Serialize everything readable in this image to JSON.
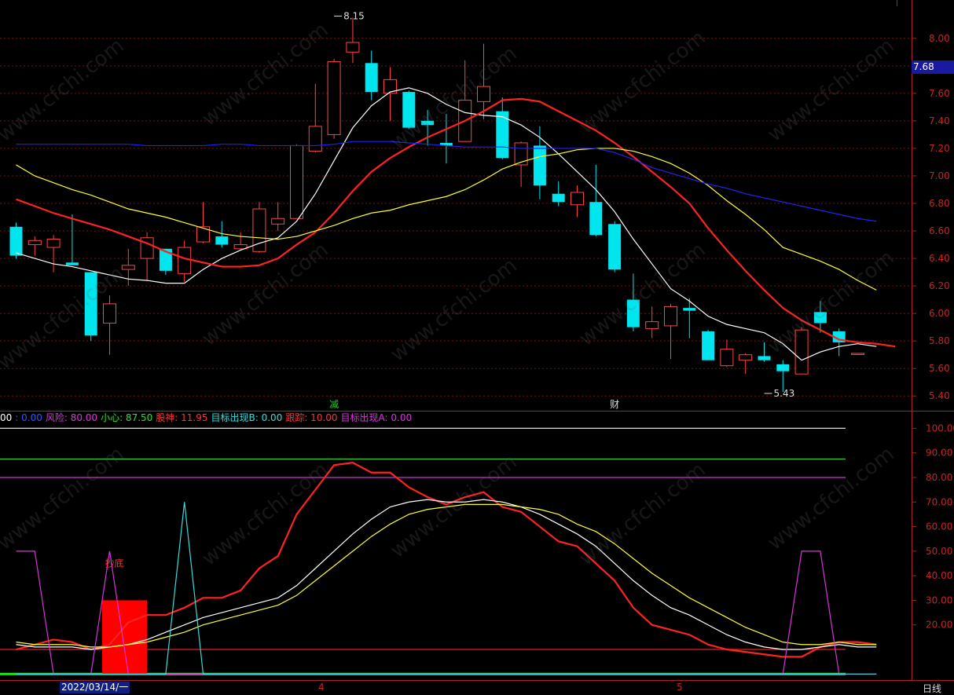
{
  "price_tag": "7.68",
  "date_label": "2022/03/14/一",
  "period_label": "日线",
  "x_labels": [
    "4",
    "5"
  ],
  "watermark": "www.cfchi.com",
  "legend": [
    {
      "text": "00",
      "color": "#ffffff"
    },
    {
      "text": ": 0.00",
      "color": "#3355ff"
    },
    {
      "text": "风险: 80.00",
      "color": "#dd33dd"
    },
    {
      "text": "小心: 87.50",
      "color": "#33dd33"
    },
    {
      "text": "股神: 11.95",
      "color": "#ff3333"
    },
    {
      "text": "目标出现B: 0.00",
      "color": "#33dddd"
    },
    {
      "text": "跟踪: 10.00",
      "color": "#ff3333"
    },
    {
      "text": "目标出现A: 0.00",
      "color": "#dd33dd"
    }
  ],
  "chart_data": [
    {
      "type": "candlestick",
      "y_ticks": [
        5.4,
        5.6,
        5.8,
        6.0,
        6.2,
        6.4,
        6.6,
        6.8,
        7.0,
        7.2,
        7.4,
        7.6,
        7.8,
        8.0
      ],
      "ylim": [
        5.31,
        8.25
      ],
      "annotations": [
        {
          "text": "8.15",
          "value": 8.15,
          "index": 17
        },
        {
          "text": "5.43",
          "value": 5.43,
          "index": 40
        }
      ],
      "event_markers": [
        {
          "text": "减",
          "index": 17,
          "color": "#22cc22"
        },
        {
          "text": "财",
          "index": 32,
          "color": "#dddddd"
        }
      ],
      "candles": [
        {
          "o": 6.63,
          "h": 6.66,
          "l": 6.4,
          "c": 6.42
        },
        {
          "o": 6.5,
          "h": 6.56,
          "l": 6.42,
          "c": 6.53
        },
        {
          "o": 6.48,
          "h": 6.57,
          "l": 6.3,
          "c": 6.54
        },
        {
          "o": 6.37,
          "h": 6.72,
          "l": 6.35,
          "c": 6.35
        },
        {
          "o": 6.3,
          "h": 6.3,
          "l": 5.8,
          "c": 5.84
        },
        {
          "o": 5.93,
          "h": 6.13,
          "l": 5.7,
          "c": 6.07
        },
        {
          "o": 6.32,
          "h": 6.47,
          "l": 6.2,
          "c": 6.35
        },
        {
          "o": 6.4,
          "h": 6.59,
          "l": 6.24,
          "c": 6.55
        },
        {
          "o": 6.47,
          "h": 6.47,
          "l": 6.28,
          "c": 6.31
        },
        {
          "o": 6.29,
          "h": 6.53,
          "l": 6.23,
          "c": 6.48
        },
        {
          "o": 6.52,
          "h": 6.81,
          "l": 6.51,
          "c": 6.63
        },
        {
          "o": 6.56,
          "h": 6.67,
          "l": 6.48,
          "c": 6.5
        },
        {
          "o": 6.47,
          "h": 6.59,
          "l": 6.46,
          "c": 6.5
        },
        {
          "o": 6.45,
          "h": 6.81,
          "l": 6.44,
          "c": 6.76
        },
        {
          "o": 6.65,
          "h": 6.81,
          "l": 6.6,
          "c": 6.69
        },
        {
          "o": 6.69,
          "h": 7.23,
          "l": 6.69,
          "c": 7.22
        },
        {
          "o": 7.18,
          "h": 7.67,
          "l": 7.17,
          "c": 7.36
        },
        {
          "o": 7.3,
          "h": 7.85,
          "l": 7.27,
          "c": 7.83
        },
        {
          "o": 7.9,
          "h": 8.15,
          "l": 7.82,
          "c": 7.97
        },
        {
          "o": 7.82,
          "h": 7.91,
          "l": 7.55,
          "c": 7.61
        },
        {
          "o": 7.6,
          "h": 7.79,
          "l": 7.4,
          "c": 7.7
        },
        {
          "o": 7.61,
          "h": 7.62,
          "l": 7.34,
          "c": 7.35
        },
        {
          "o": 7.4,
          "h": 7.48,
          "l": 7.22,
          "c": 7.37
        },
        {
          "o": 7.24,
          "h": 7.45,
          "l": 7.09,
          "c": 7.22
        },
        {
          "o": 7.25,
          "h": 7.84,
          "l": 7.25,
          "c": 7.55
        },
        {
          "o": 7.54,
          "h": 7.96,
          "l": 7.41,
          "c": 7.65
        },
        {
          "o": 7.47,
          "h": 7.57,
          "l": 7.12,
          "c": 7.13
        },
        {
          "o": 7.08,
          "h": 7.25,
          "l": 6.92,
          "c": 7.24
        },
        {
          "o": 7.22,
          "h": 7.36,
          "l": 6.83,
          "c": 6.93
        },
        {
          "o": 6.87,
          "h": 6.96,
          "l": 6.78,
          "c": 6.81
        },
        {
          "o": 6.79,
          "h": 6.93,
          "l": 6.7,
          "c": 6.88
        },
        {
          "o": 6.81,
          "h": 7.08,
          "l": 6.56,
          "c": 6.57
        },
        {
          "o": 6.65,
          "h": 6.67,
          "l": 6.3,
          "c": 6.32
        },
        {
          "o": 6.1,
          "h": 6.29,
          "l": 5.87,
          "c": 5.9
        },
        {
          "o": 5.89,
          "h": 6.05,
          "l": 5.82,
          "c": 5.94
        },
        {
          "o": 5.91,
          "h": 6.07,
          "l": 5.67,
          "c": 6.05
        },
        {
          "o": 6.04,
          "h": 6.11,
          "l": 5.82,
          "c": 6.02
        },
        {
          "o": 5.87,
          "h": 5.88,
          "l": 5.66,
          "c": 5.66
        },
        {
          "o": 5.62,
          "h": 5.81,
          "l": 5.61,
          "c": 5.74
        },
        {
          "o": 5.66,
          "h": 5.71,
          "l": 5.56,
          "c": 5.7
        },
        {
          "o": 5.69,
          "h": 5.79,
          "l": 5.65,
          "c": 5.66
        },
        {
          "o": 5.63,
          "h": 5.66,
          "l": 5.43,
          "c": 5.58
        },
        {
          "o": 5.56,
          "h": 5.9,
          "l": 5.56,
          "c": 5.88
        },
        {
          "o": 6.01,
          "h": 6.09,
          "l": 5.86,
          "c": 5.93
        },
        {
          "o": 5.87,
          "h": 5.89,
          "l": 5.69,
          "c": 5.79
        },
        {
          "o": 5.71,
          "h": 5.71,
          "l": 5.71,
          "c": 5.71
        }
      ],
      "ma_lines": [
        {
          "color": "#ffffff",
          "values": [
            6.44,
            6.4,
            6.36,
            6.34,
            6.31,
            6.28,
            6.25,
            6.24,
            6.22,
            6.22,
            6.32,
            6.4,
            6.46,
            6.51,
            6.55,
            6.67,
            6.87,
            7.11,
            7.35,
            7.51,
            7.61,
            7.64,
            7.6,
            7.52,
            7.46,
            7.44,
            7.43,
            7.37,
            7.28,
            7.16,
            7.03,
            6.9,
            6.74,
            6.54,
            6.36,
            6.18,
            6.09,
            5.98,
            5.92,
            5.89,
            5.86,
            5.78,
            5.66,
            5.72,
            5.76,
            5.78,
            5.76
          ]
        },
        {
          "color": "#ff2222",
          "values": [
            6.83,
            6.78,
            6.73,
            6.69,
            6.65,
            6.61,
            6.56,
            6.51,
            6.45,
            6.4,
            6.37,
            6.34,
            6.34,
            6.35,
            6.4,
            6.5,
            6.59,
            6.73,
            6.89,
            7.03,
            7.13,
            7.21,
            7.28,
            7.34,
            7.4,
            7.47,
            7.55,
            7.56,
            7.54,
            7.47,
            7.4,
            7.33,
            7.24,
            7.14,
            7.03,
            6.92,
            6.8,
            6.62,
            6.46,
            6.31,
            6.17,
            6.04,
            5.95,
            5.88,
            5.81,
            5.79,
            5.78,
            5.76
          ]
        },
        {
          "color": "#ffff33",
          "values": [
            7.08,
            7.0,
            6.95,
            6.9,
            6.86,
            6.81,
            6.76,
            6.73,
            6.7,
            6.66,
            6.62,
            6.58,
            6.56,
            6.55,
            6.54,
            6.56,
            6.6,
            6.64,
            6.69,
            6.73,
            6.75,
            6.79,
            6.82,
            6.85,
            6.9,
            6.97,
            7.05,
            7.1,
            7.14,
            7.16,
            7.19,
            7.2,
            7.2,
            7.18,
            7.14,
            7.09,
            7.02,
            6.93,
            6.82,
            6.72,
            6.61,
            6.48,
            6.43,
            6.38,
            6.32,
            6.24,
            6.17
          ]
        },
        {
          "color": "#2222ee",
          "values": [
            7.23,
            7.23,
            7.23,
            7.23,
            7.23,
            7.23,
            7.23,
            7.22,
            7.22,
            7.22,
            7.22,
            7.23,
            7.23,
            7.22,
            7.22,
            7.22,
            7.22,
            7.23,
            7.25,
            7.25,
            7.25,
            7.24,
            7.23,
            7.22,
            7.21,
            7.21,
            7.21,
            7.2,
            7.2,
            7.2,
            7.2,
            7.2,
            7.17,
            7.12,
            7.06,
            7.02,
            6.98,
            6.94,
            6.91,
            6.87,
            6.84,
            6.81,
            6.78,
            6.75,
            6.72,
            6.69,
            6.67
          ]
        }
      ]
    },
    {
      "type": "line",
      "y_ticks": [
        20,
        30,
        40,
        50,
        60,
        70,
        80,
        90,
        100
      ],
      "ylim": [
        -1.5,
        103
      ],
      "annotations": [
        {
          "text": "抄底",
          "index": 5,
          "value": 45
        }
      ],
      "hlines": [
        {
          "value": 100,
          "color": "#dddddd"
        },
        {
          "value": 87.5,
          "color": "#33cc33"
        },
        {
          "value": 80,
          "color": "#cc33cc"
        },
        {
          "value": 10,
          "color": "#dd2222"
        },
        {
          "value": 0,
          "color": "#00ff00"
        }
      ],
      "bars": [
        {
          "start": 4.6,
          "end": 7.0,
          "value": 30,
          "color": "#ff0000"
        }
      ],
      "series": [
        {
          "color": "#ff2222",
          "values": [
            10,
            12,
            14,
            13,
            10,
            12,
            21,
            24,
            24,
            27,
            31,
            31,
            34,
            43,
            48,
            65,
            75,
            85,
            86,
            82,
            82,
            76,
            72,
            69,
            72,
            74,
            68,
            66,
            60,
            54,
            52,
            45,
            38,
            27,
            20,
            18,
            16,
            12,
            10,
            9,
            8,
            7,
            7,
            11,
            13,
            13,
            12
          ]
        },
        {
          "color": "#ffffff",
          "values": [
            12,
            11,
            11,
            11,
            10,
            11,
            12,
            14,
            17,
            20,
            23,
            25,
            27,
            29,
            31,
            36,
            43,
            50,
            57,
            63,
            68,
            70,
            71,
            70,
            70,
            71,
            70,
            68,
            65,
            61,
            57,
            52,
            45,
            38,
            32,
            27,
            24,
            20,
            16,
            13,
            11,
            10,
            10,
            11,
            12,
            11,
            11
          ]
        },
        {
          "color": "#ffff33",
          "values": [
            13,
            12,
            12,
            12,
            11,
            11,
            12,
            13,
            15,
            17,
            20,
            22,
            24,
            26,
            28,
            32,
            38,
            44,
            50,
            56,
            61,
            65,
            67,
            68,
            69,
            69,
            69,
            68,
            67,
            65,
            61,
            58,
            53,
            47,
            41,
            36,
            31,
            27,
            23,
            19,
            16,
            13,
            12,
            12,
            13,
            12,
            12
          ]
        },
        {
          "color": "#dd33dd",
          "values": [
            50,
            50,
            0,
            0,
            0,
            50,
            0,
            0,
            0,
            0,
            0,
            0,
            0,
            0,
            0,
            0,
            0,
            0,
            0,
            0,
            0,
            0,
            0,
            0,
            0,
            0,
            0,
            0,
            0,
            0,
            0,
            0,
            0,
            0,
            0,
            0,
            0,
            0,
            0,
            0,
            0,
            0,
            50,
            50,
            0,
            0,
            0
          ]
        },
        {
          "color": "#33dddd",
          "values": [
            0,
            0,
            0,
            0,
            0,
            0,
            0,
            0,
            0,
            70,
            0,
            0,
            0,
            0,
            0,
            0,
            0,
            0,
            0,
            0,
            0,
            0,
            0,
            0,
            0,
            0,
            0,
            0,
            0,
            0,
            0,
            0,
            0,
            0,
            0,
            0,
            0,
            0,
            0,
            0,
            0,
            0,
            0,
            0,
            0,
            0,
            0
          ]
        }
      ]
    }
  ]
}
